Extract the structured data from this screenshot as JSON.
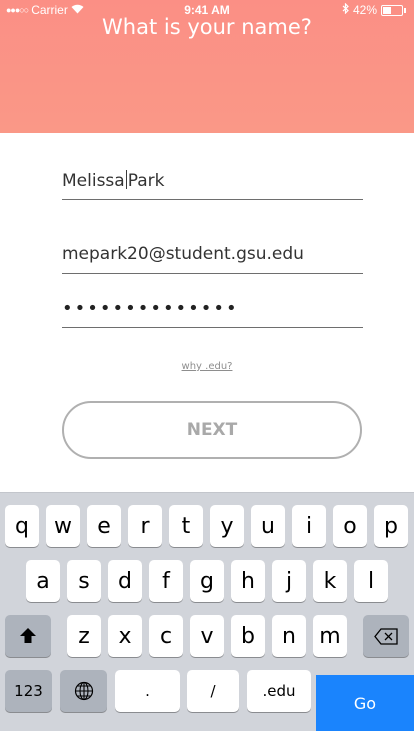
{
  "status_bar": {
    "carrier": "Carrier",
    "time": "9:41 AM",
    "battery": "42%",
    "battery_level": 0.42
  },
  "header": {
    "title": "What is your name?",
    "background": "#fb8f85"
  },
  "form": {
    "name_value_first": "Melissa",
    "name_value_last": "Park",
    "email_value": "mepark20@student.gsu.edu",
    "password_value": "••••••••••••••",
    "why_link": "why .edu?",
    "next_label": "NEXT"
  },
  "keyboard": {
    "row1": [
      "q",
      "w",
      "e",
      "r",
      "t",
      "y",
      "u",
      "i",
      "o",
      "p"
    ],
    "row2": [
      "a",
      "s",
      "d",
      "f",
      "g",
      "h",
      "j",
      "k",
      "l"
    ],
    "row3": [
      "z",
      "x",
      "c",
      "v",
      "b",
      "n",
      "m"
    ],
    "numbers_label": "123",
    "period_label": ".",
    "slash_label": "/",
    "edu_label": ".edu",
    "go_label": "Go",
    "go_color": "#1a84fd"
  }
}
